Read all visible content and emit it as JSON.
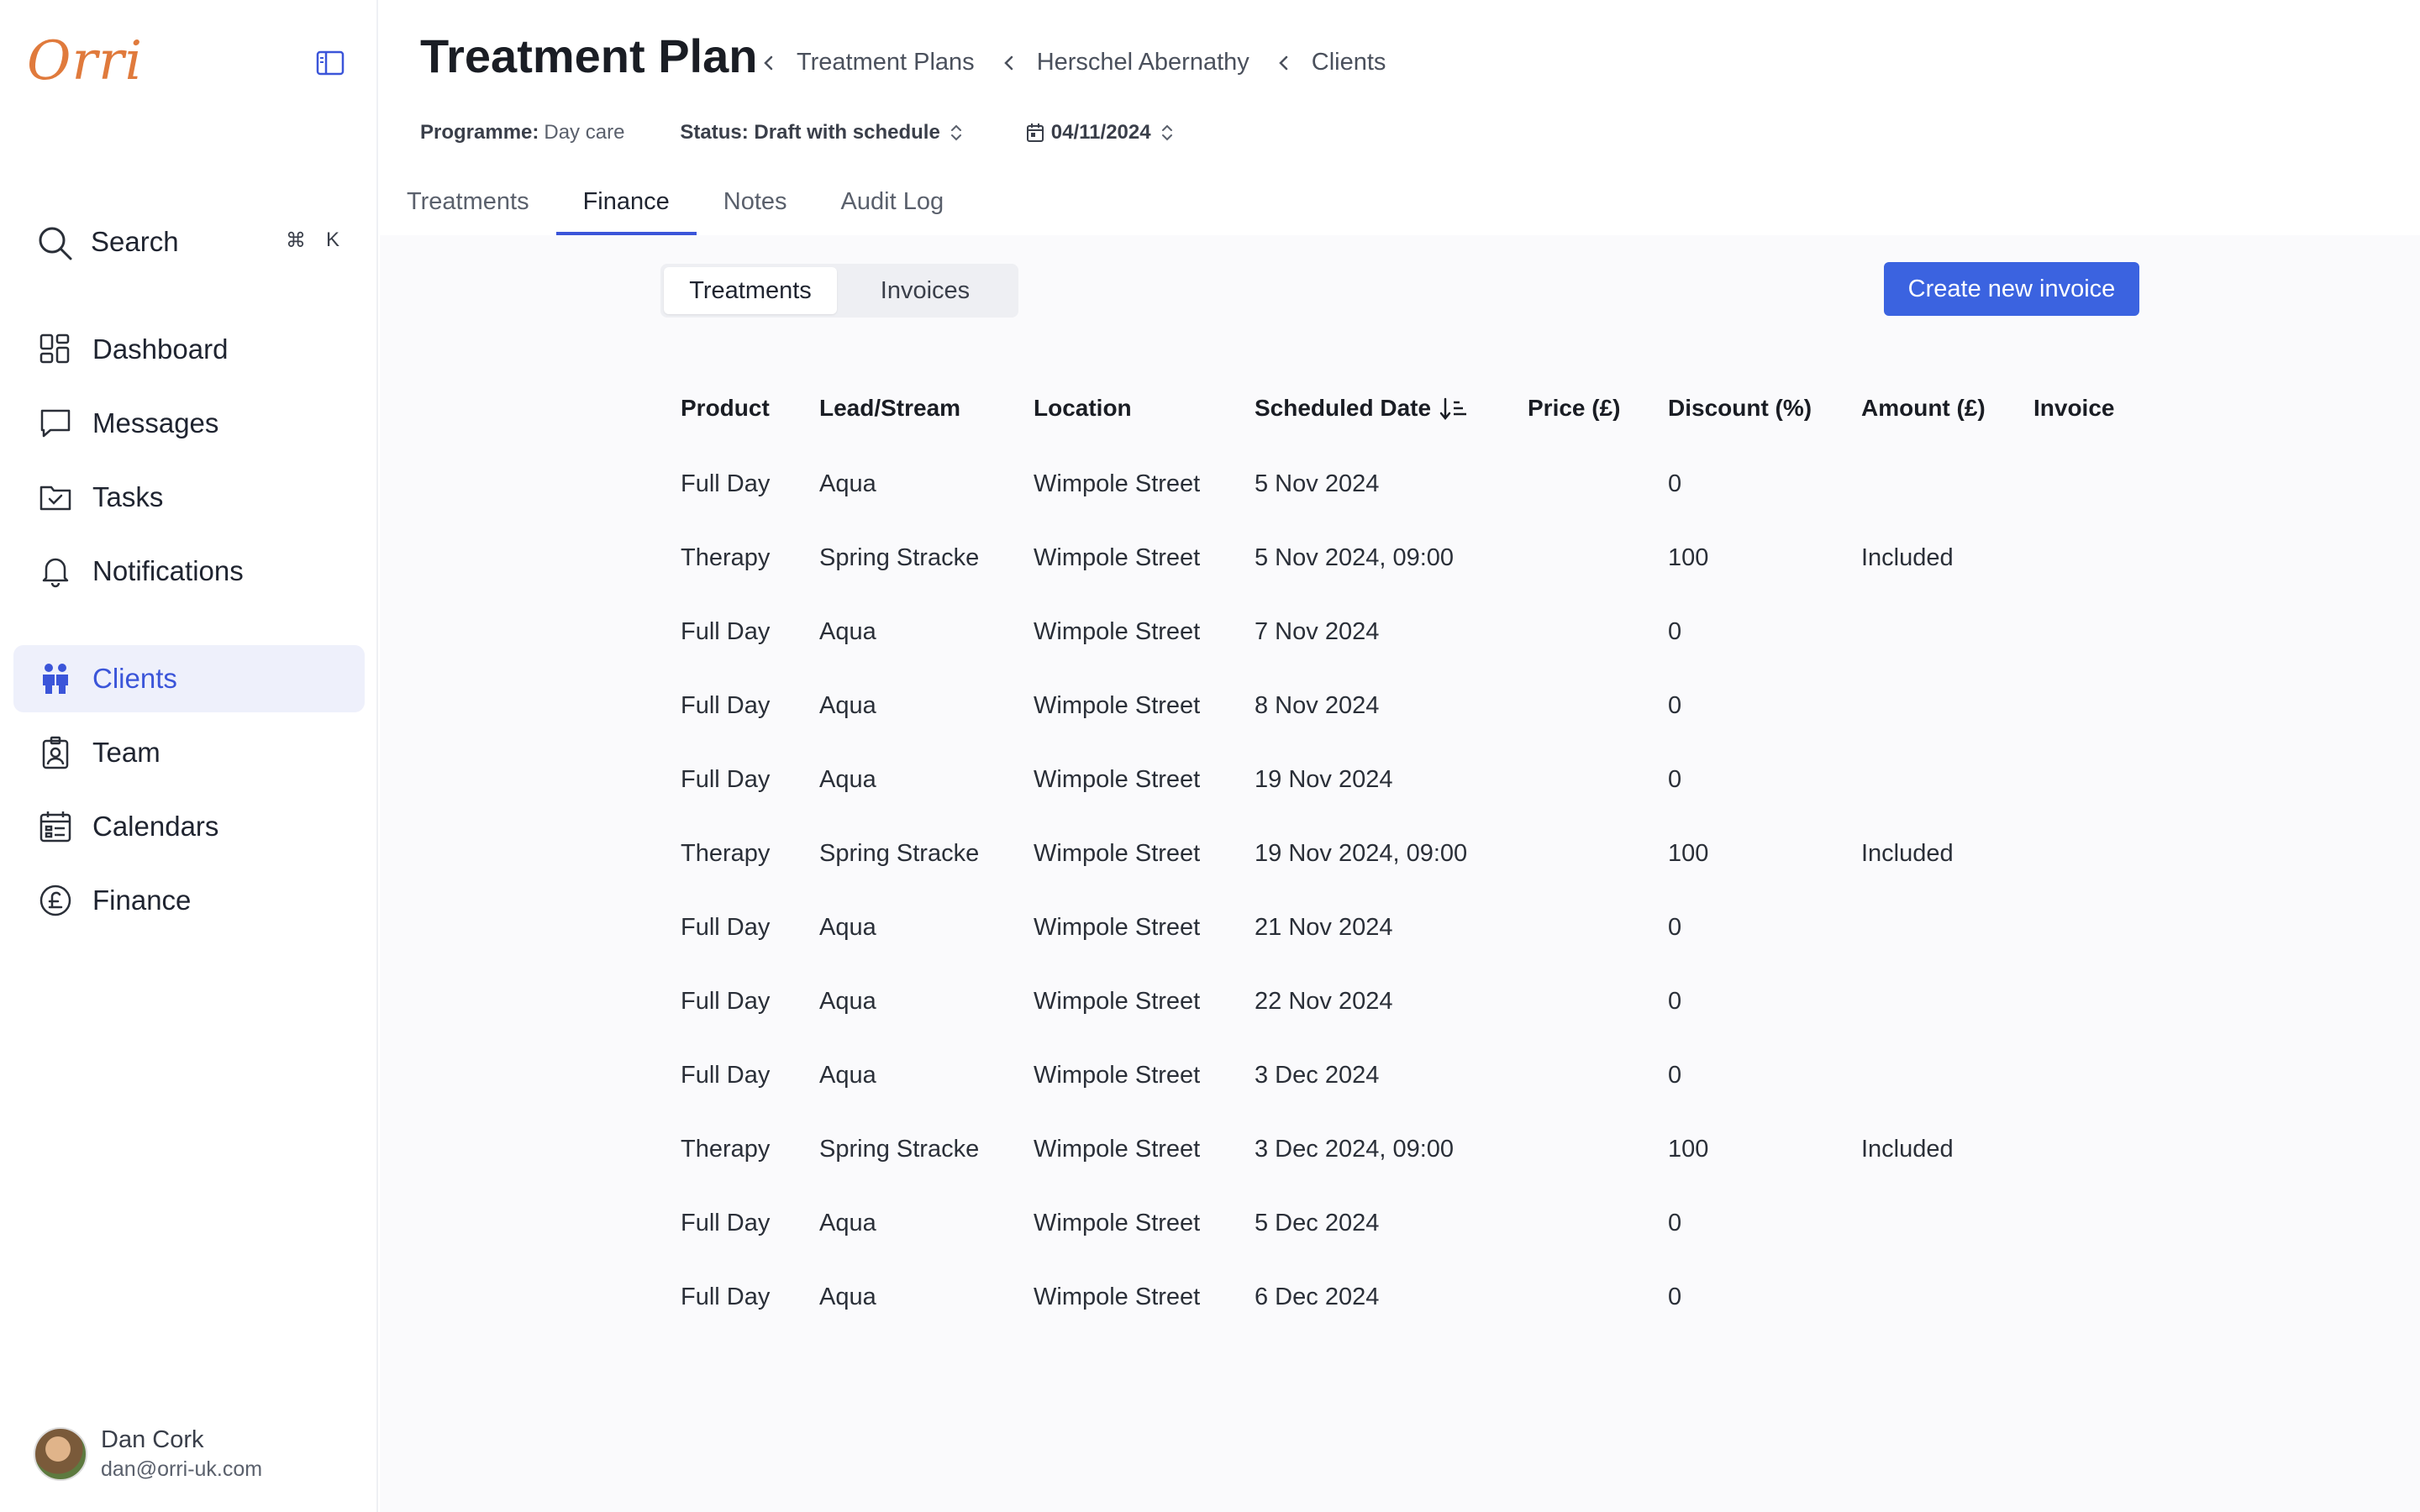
{
  "app": {
    "logo": "Orri"
  },
  "sidebar": {
    "search": {
      "label": "Search",
      "shortcut_cmd": "⌘",
      "shortcut_key": "K"
    },
    "items": [
      {
        "label": "Dashboard",
        "icon": "dashboard-icon"
      },
      {
        "label": "Messages",
        "icon": "message-icon"
      },
      {
        "label": "Tasks",
        "icon": "tasks-icon"
      },
      {
        "label": "Notifications",
        "icon": "bell-icon"
      },
      {
        "label": "Clients",
        "icon": "clients-icon",
        "active": true
      },
      {
        "label": "Team",
        "icon": "team-badge-icon"
      },
      {
        "label": "Calendars",
        "icon": "calendar-icon"
      },
      {
        "label": "Finance",
        "icon": "pound-icon"
      }
    ],
    "user": {
      "name": "Dan Cork",
      "email": "dan@orri-uk.com"
    }
  },
  "header": {
    "title": "Treatment Plan",
    "breadcrumb": [
      "Treatment Plans",
      "Herschel Abernathy",
      "Clients"
    ],
    "programme_label": "Programme:",
    "programme_value": "Day care",
    "status_label": "Status: Draft with schedule",
    "date_value": "04/11/2024",
    "tabs": [
      "Treatments",
      "Finance",
      "Notes",
      "Audit Log"
    ],
    "active_tab": "Finance"
  },
  "finance": {
    "segments": [
      "Treatments",
      "Invoices"
    ],
    "active_segment": "Treatments",
    "create_button": "Create new invoice",
    "columns": [
      "Product",
      "Lead/Stream",
      "Location",
      "Scheduled Date",
      "Price (£)",
      "Discount (%)",
      "Amount (£)",
      "Invoice"
    ],
    "rows": [
      [
        "Full Day",
        "Aqua",
        "Wimpole Street",
        "5 Nov 2024",
        "",
        "0",
        "",
        ""
      ],
      [
        "Therapy",
        "Spring Stracke",
        "Wimpole Street",
        "5 Nov 2024, 09:00",
        "",
        "100",
        "Included",
        ""
      ],
      [
        "Full Day",
        "Aqua",
        "Wimpole Street",
        "7 Nov 2024",
        "",
        "0",
        "",
        ""
      ],
      [
        "Full Day",
        "Aqua",
        "Wimpole Street",
        "8 Nov 2024",
        "",
        "0",
        "",
        ""
      ],
      [
        "Full Day",
        "Aqua",
        "Wimpole Street",
        "19 Nov 2024",
        "",
        "0",
        "",
        ""
      ],
      [
        "Therapy",
        "Spring Stracke",
        "Wimpole Street",
        "19 Nov 2024, 09:00",
        "",
        "100",
        "Included",
        ""
      ],
      [
        "Full Day",
        "Aqua",
        "Wimpole Street",
        "21 Nov 2024",
        "",
        "0",
        "",
        ""
      ],
      [
        "Full Day",
        "Aqua",
        "Wimpole Street",
        "22 Nov 2024",
        "",
        "0",
        "",
        ""
      ],
      [
        "Full Day",
        "Aqua",
        "Wimpole Street",
        "3 Dec 2024",
        "",
        "0",
        "",
        ""
      ],
      [
        "Therapy",
        "Spring Stracke",
        "Wimpole Street",
        "3 Dec 2024, 09:00",
        "",
        "100",
        "Included",
        ""
      ],
      [
        "Full Day",
        "Aqua",
        "Wimpole Street",
        "5 Dec 2024",
        "",
        "0",
        "",
        ""
      ],
      [
        "Full Day",
        "Aqua",
        "Wimpole Street",
        "6 Dec 2024",
        "",
        "0",
        "",
        ""
      ]
    ]
  },
  "colors": {
    "accent": "#3b55d9",
    "button": "#3b63e0",
    "logo": "#e07a3c"
  }
}
